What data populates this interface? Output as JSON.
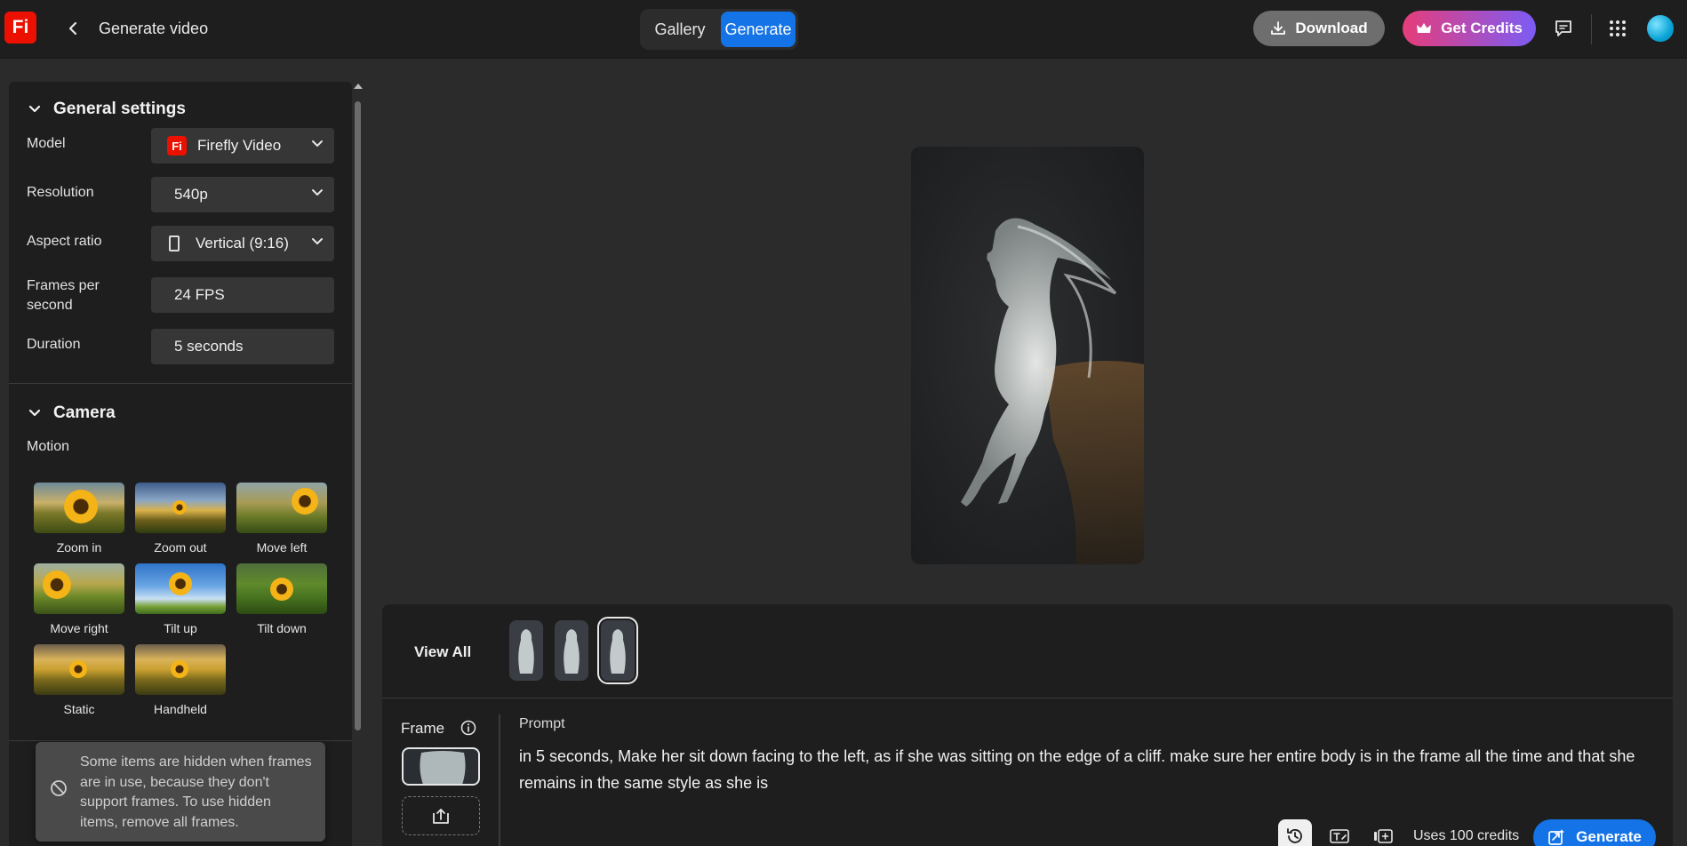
{
  "header": {
    "logo_text": "Fi",
    "title": "Generate video",
    "tabs": [
      {
        "label": "Gallery",
        "active": false
      },
      {
        "label": "Generate",
        "active": true
      }
    ],
    "download_label": "Download",
    "credits_label": "Get Credits",
    "accent_color": "#1473e6",
    "credits_gradient": [
      "#e63d7a",
      "#7c5cf5"
    ]
  },
  "settings": {
    "general_title": "General settings",
    "model_label": "Model",
    "model_value": "Firefly Video",
    "model_badge": "Fi",
    "resolution_label": "Resolution",
    "resolution_value": "540p",
    "aspect_label": "Aspect ratio",
    "aspect_value": "Vertical (9:16)",
    "fps_label_1": "Frames per",
    "fps_label_2": "second",
    "fps_value": "24 FPS",
    "duration_label": "Duration",
    "duration_value": "5 seconds",
    "camera_title": "Camera",
    "motion_label": "Motion",
    "motions": [
      "Zoom in",
      "Zoom out",
      "Move left",
      "Move right",
      "Tilt up",
      "Tilt down",
      "Static",
      "Handheld"
    ]
  },
  "toast": {
    "message": "Some items are hidden when frames are in use, because they don't support frames. To use hidden items, remove all frames.",
    "icon": "blocked-icon"
  },
  "composer": {
    "view_all": "View All",
    "frame_label": "Frame",
    "prompt_label": "Prompt",
    "prompt_text": "in 5 seconds, Make her sit down facing to the left, as if she was sitting on the edge of a cliff. make sure her entire body is in the frame all the time and that she remains in the same style as she is",
    "uses_credits": "Uses 100 credits",
    "generate_label": "Generate"
  }
}
